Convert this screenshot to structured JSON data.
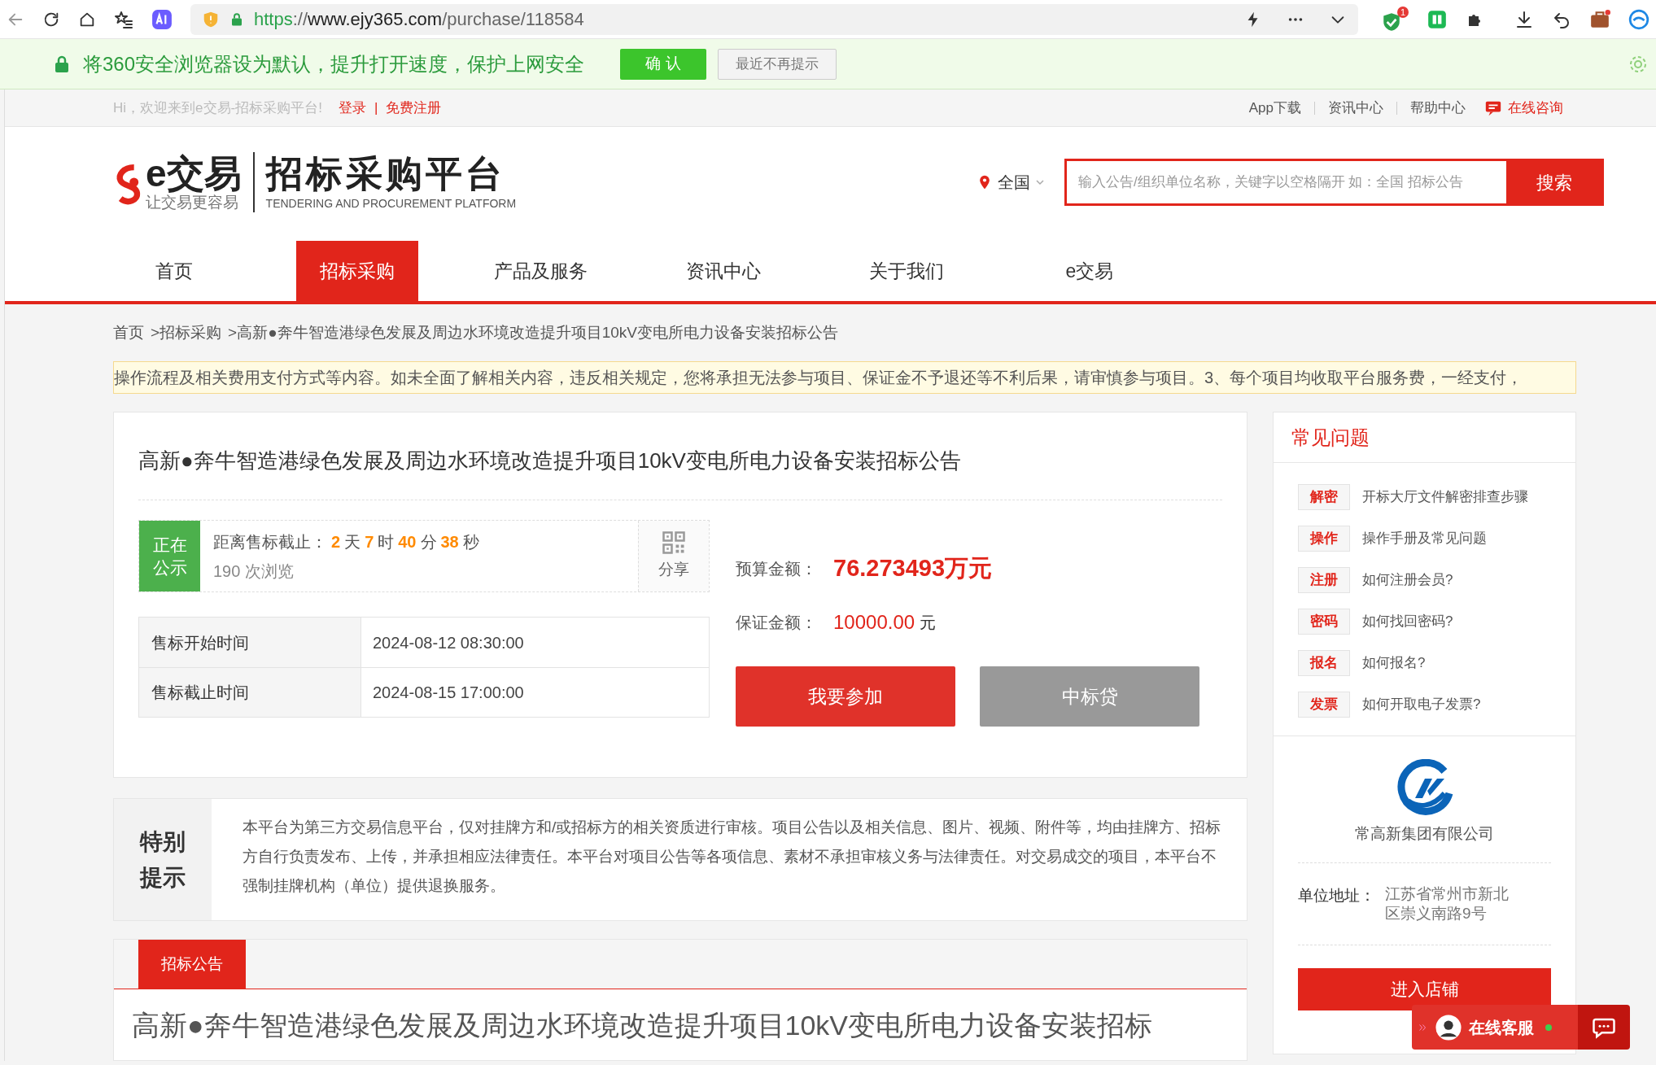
{
  "browser": {
    "url": {
      "scheme": "https",
      "separator": "://",
      "host": "www.ejy365.com",
      "path": "/purchase/118584"
    },
    "extension_badge": "1"
  },
  "infobar": {
    "message": "将360安全浏览器设为默认，提升打开速度，保护上网安全",
    "confirm_button": "确 认",
    "dismiss_button": "最近不再提示"
  },
  "topbar": {
    "greeting": "Hi，欢迎来到e交易-招标采购平台!",
    "login": "登录",
    "separator": "|",
    "register": "免费注册",
    "links": [
      "App下载",
      "资讯中心",
      "帮助中心"
    ],
    "consult": "在线咨询"
  },
  "header": {
    "logo_name": "e交易",
    "logo_slogan": "让交易更容易",
    "platform_name": "招标采购平台",
    "platform_name_en": "TENDERING AND PROCUREMENT PLATFORM",
    "location": "全国",
    "search": {
      "placeholder": "输入公告/组织单位名称，关键字以空格隔开 如：全国 招标公告"
    },
    "search_button": "搜索"
  },
  "nav": [
    {
      "label": "首页",
      "selected": false
    },
    {
      "label": "招标采购",
      "selected": true
    },
    {
      "label": "产品及服务",
      "selected": false
    },
    {
      "label": "资讯中心",
      "selected": false
    },
    {
      "label": "关于我们",
      "selected": false
    },
    {
      "label": "e交易",
      "selected": false
    }
  ],
  "breadcrumb": {
    "separator": ">",
    "items": [
      "首页",
      "招标采购",
      "高新●奔牛智造港绿色发展及周边水环境改造提升项目10kV变电所电力设备安装招标公告"
    ]
  },
  "notice_ticker": "操作流程及相关费用支付方式等内容。如未全面了解相关内容，违反相关规定，您将承担无法参与项目、保证金不予退还等不利后果，请审慎参与项目。3、每个项目均收取平台服务费，一经支付，",
  "project": {
    "title": "高新●奔牛智造港绿色发展及周边水环境改造提升项目10kV变电所电力设备安装招标公告",
    "status": "正在公示",
    "countdown_label": "距离售标截止：",
    "countdown": [
      {
        "value": "2",
        "unit": "天"
      },
      {
        "value": "7",
        "unit": "时"
      },
      {
        "value": "40",
        "unit": "分"
      },
      {
        "value": "38",
        "unit": "秒"
      }
    ],
    "views": "190",
    "views_unit": "次浏览",
    "share": "分享",
    "times": [
      {
        "label": "售标开始时间",
        "value": "2024-08-12 08:30:00"
      },
      {
        "label": "售标截止时间",
        "value": "2024-08-15 17:00:00"
      }
    ],
    "budget_label": "预算金额：",
    "budget": "76.273493万元",
    "deposit_label": "保证金额：",
    "deposit": "10000.00",
    "deposit_unit": "元",
    "buttons": [
      {
        "label": "我要参加",
        "kind": "primary"
      },
      {
        "label": "中标贷",
        "kind": "secondary"
      }
    ]
  },
  "special_notice": {
    "title": "特别提示",
    "text": "本平台为第三方交易信息平台，仅对挂牌方和/或招标方的相关资质进行审核。项目公告以及相关信息、图片、视频、附件等，均由挂牌方、招标方自行负责发布、上传，并承担相应法律责任。本平台对项目公告等各项信息、素材不承担审核义务与法律责任。对交易成交的项目，本平台不强制挂牌机构（单位）提供退换服务。"
  },
  "content_tabs": [
    {
      "label": "招标公告",
      "selected": true
    }
  ],
  "content_title": "高新●奔牛智造港绿色发展及周边水环境改造提升项目10kV变电所电力设备安装招标",
  "sidebar": {
    "faq_title": "常见问题",
    "faq": [
      {
        "tag": "解密",
        "text": "开标大厅文件解密排查步骤"
      },
      {
        "tag": "操作",
        "text": "操作手册及常见问题"
      },
      {
        "tag": "注册",
        "text": "如何注册会员?"
      },
      {
        "tag": "密码",
        "text": "如何找回密码?"
      },
      {
        "tag": "报名",
        "text": "如何报名?"
      },
      {
        "tag": "发票",
        "text": "如何开取电子发票?"
      }
    ],
    "company": "常高新集团有限公司",
    "address_label": "单位地址：",
    "address": "江苏省常州市新北区崇义南路9号",
    "store_button": "进入店铺"
  },
  "chat_widget": {
    "label": "在线客服",
    "online": true
  }
}
